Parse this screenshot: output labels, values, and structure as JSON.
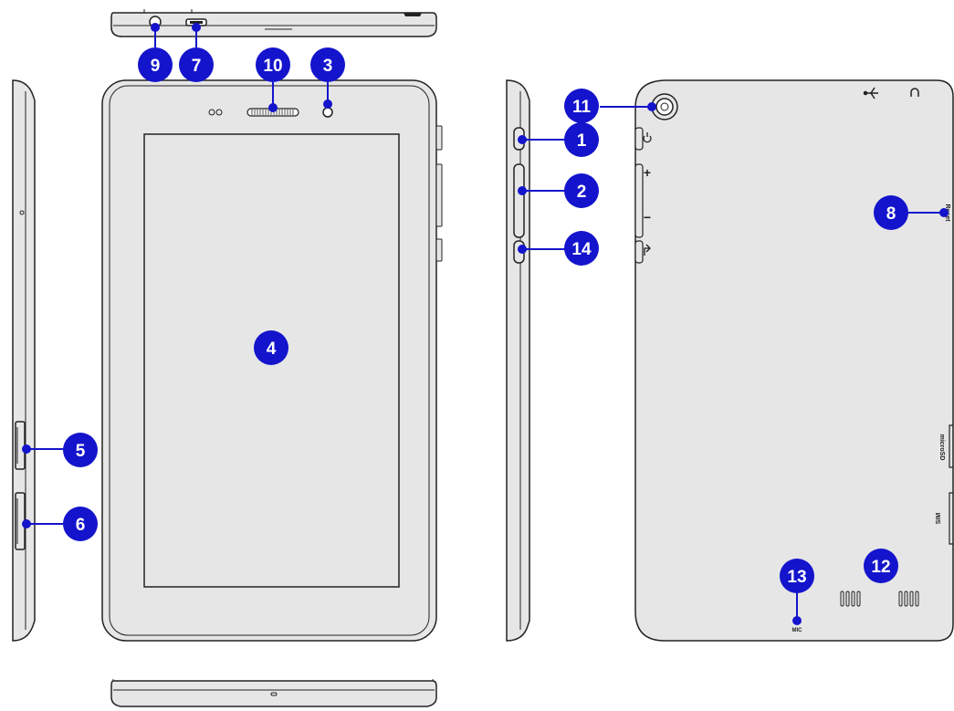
{
  "colors": {
    "device_body": "#e6e6e6",
    "device_outline": "#222222",
    "callout_fill": "#1414cc",
    "callout_text": "#ffffff",
    "leader_line": "#1414cc"
  },
  "callouts": {
    "power_button": "1",
    "volume_rocker": "2",
    "front_camera": "3",
    "touchscreen": "4",
    "left_port_upper": "5",
    "left_port_lower": "6",
    "micro_usb_port": "7",
    "reset_hole": "8",
    "audio_jack": "9",
    "receiver_speaker": "10",
    "rear_camera": "11",
    "rear_speakers": "12",
    "microphone": "13",
    "windows_button": "14"
  },
  "back_labels": {
    "reset": "Reset",
    "microsd": "microSD",
    "sim": "SIM",
    "mic": "MIC",
    "plus": "+",
    "minus": "−"
  },
  "icons": {
    "power": "power-icon",
    "usb": "usb-icon",
    "headphone": "headphone-icon",
    "windows_key": "windows-key-icon"
  }
}
